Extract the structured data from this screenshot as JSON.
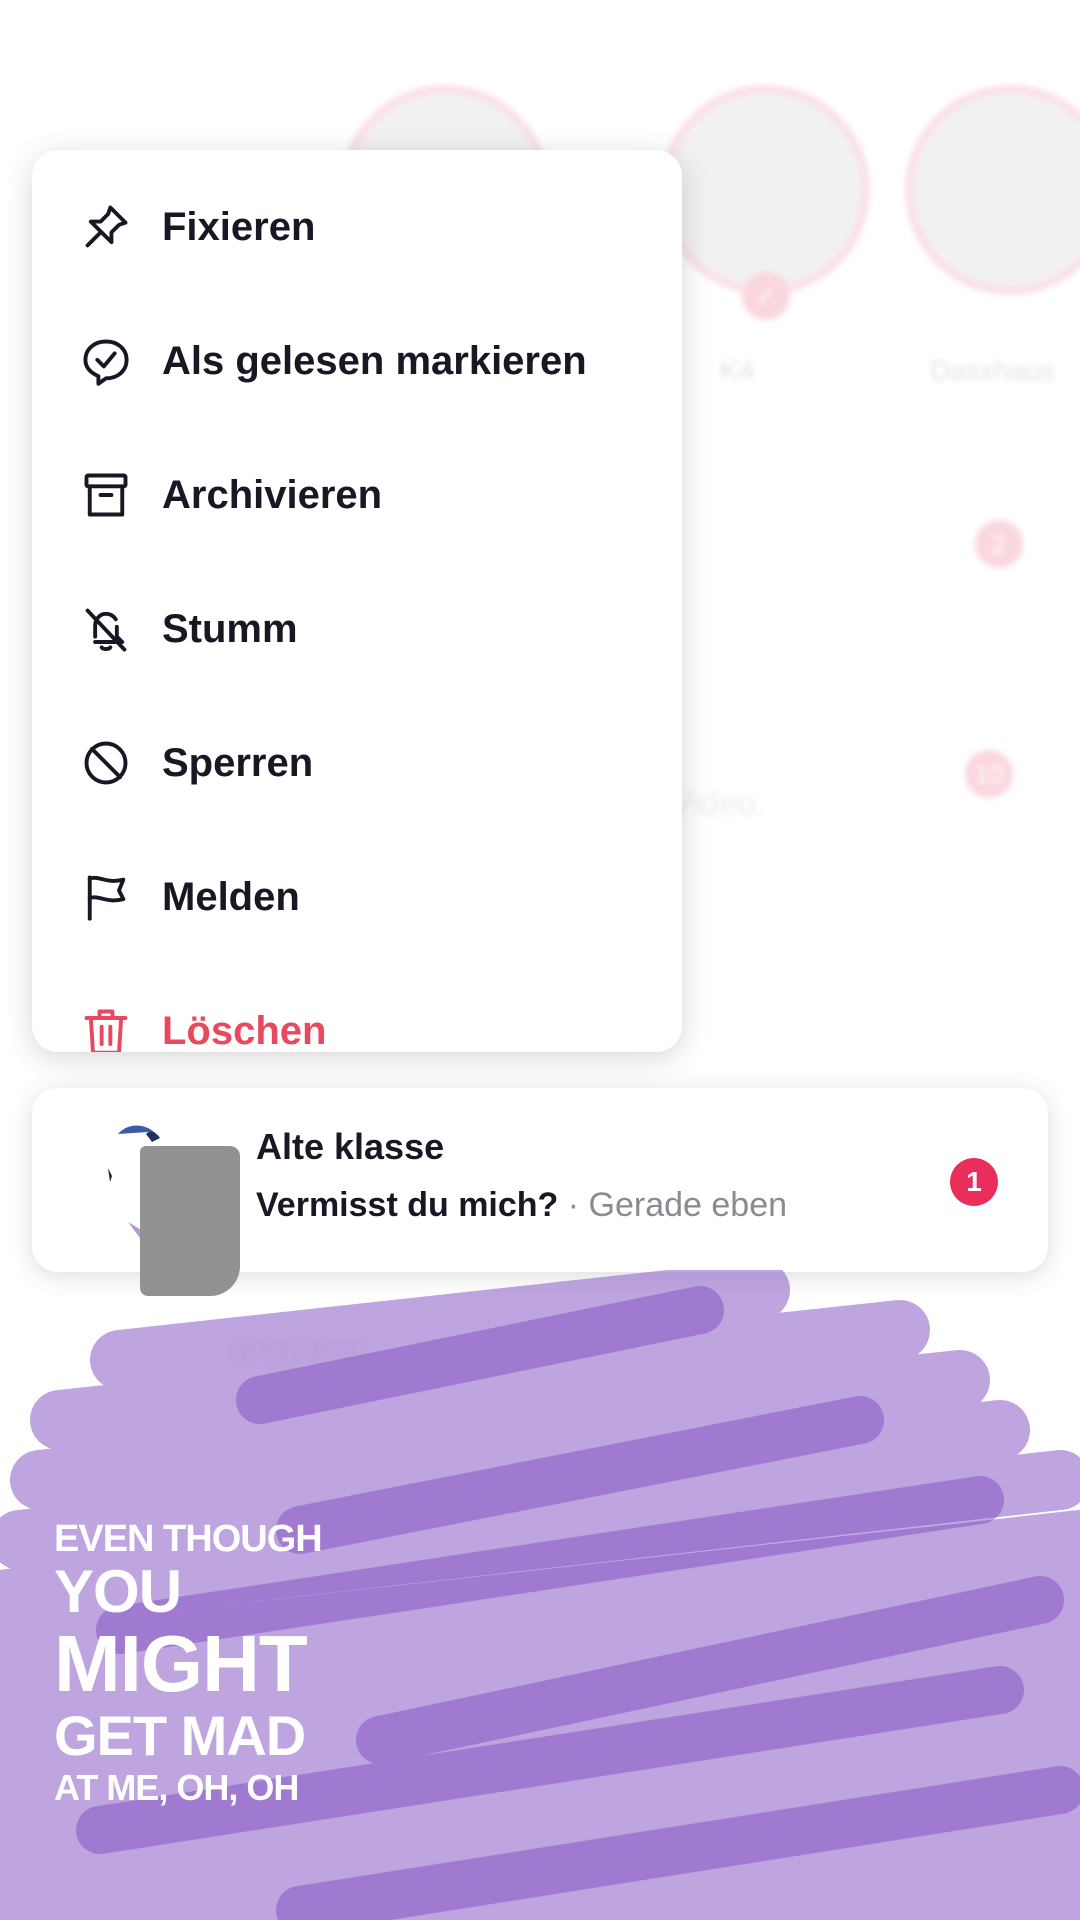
{
  "background": {
    "story_names": [
      "K4",
      "Dasxhaus"
    ],
    "badges": [
      "2",
      "10"
    ],
    "partial_text": "Video.",
    "lower_name": "angyanin"
  },
  "menu": {
    "items": [
      {
        "label": "Fixieren",
        "icon": "pin-icon"
      },
      {
        "label": "Als gelesen markieren",
        "icon": "chat-check-icon"
      },
      {
        "label": "Archivieren",
        "icon": "archive-box-icon"
      },
      {
        "label": "Stumm",
        "icon": "bell-off-icon"
      },
      {
        "label": "Sperren",
        "icon": "block-icon"
      },
      {
        "label": "Melden",
        "icon": "flag-icon"
      },
      {
        "label": "Löschen",
        "icon": "trash-icon"
      }
    ]
  },
  "chat": {
    "title": "Alte klasse",
    "message": "Vermisst du mich?",
    "separator": " · ",
    "time": "Gerade eben",
    "unread": "1"
  },
  "lyrics": {
    "line1": "EVEN THOUGH",
    "line2": "YOU",
    "line3": "MIGHT",
    "line4": "GET MAD",
    "line5": "AT ME, OH, OH"
  },
  "colors": {
    "danger": "#e8495e",
    "unread_badge": "#ea2e5c",
    "scribble": "#8a5cc6"
  }
}
